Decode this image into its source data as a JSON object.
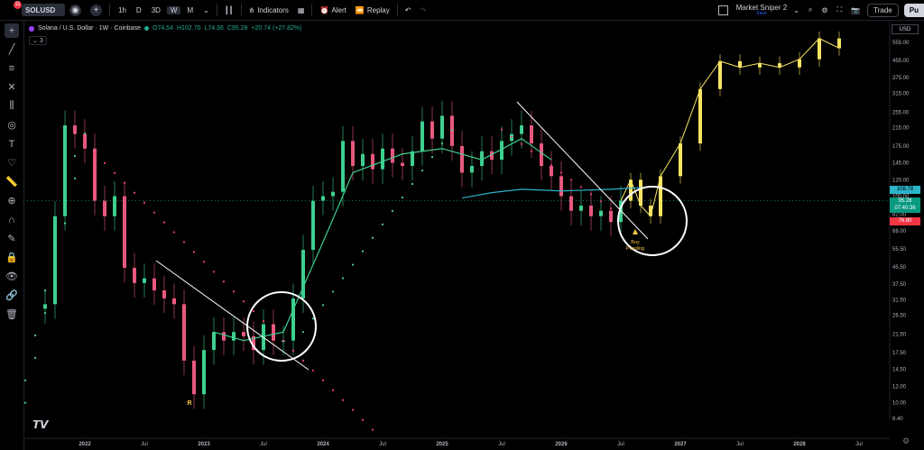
{
  "toolbar": {
    "notification_count": "11",
    "symbol": "SOLUSD",
    "timeframes": [
      "1h",
      "D",
      "3D",
      "W",
      "M"
    ],
    "active_timeframe": "W",
    "indicators_label": "Indicators",
    "alert_label": "Alert",
    "replay_label": "Replay",
    "layout_name": "Market Sniper 2",
    "layout_status": "Save",
    "trade_label": "Trade",
    "publish_label": "Pu"
  },
  "legend": {
    "title": "Solana / U.S. Dollar · 1W · Coinbase",
    "open": "O74.54",
    "high": "H102.70",
    "low": "L74.36",
    "close": "C95.28",
    "change": "+20.74 (+27.82%)",
    "indicator_count": "3"
  },
  "price_axis": {
    "currency": "USD",
    "price_tags": [
      {
        "value": "108.78",
        "color": "#2bb3c8"
      },
      {
        "value": "95.28",
        "color": "#089981"
      },
      {
        "value": "07:40:36",
        "color": "#089981"
      },
      {
        "value": "76.80",
        "color": "#f23645"
      }
    ]
  },
  "annotations": {
    "r_marker": "R",
    "buy_signal_line1": "Buy",
    "buy_signal_line2": "Pending"
  },
  "chart_data": {
    "type": "candlestick",
    "symbol": "SOLUSD",
    "exchange": "Coinbase",
    "interval": "1W",
    "scale": "log",
    "grid": false,
    "y_ticks": [
      555.0,
      455.0,
      375.0,
      315.0,
      255.0,
      215.0,
      175.0,
      145.0,
      120.0,
      100.0,
      82.0,
      68.0,
      55.5,
      45.5,
      37.5,
      31.5,
      26.5,
      21.5,
      17.5,
      14.5,
      12.0,
      10.0,
      8.4
    ],
    "x_ticks": [
      "2022",
      "Jul",
      "2023",
      "Jul",
      "2024",
      "Jul",
      "2025",
      "Jul",
      "2026",
      "Jul",
      "2027",
      "Jul",
      "2028",
      "Jul"
    ],
    "series": [
      {
        "name": "Historical price",
        "x": [
          "2021-09",
          "2021-10",
          "2021-11",
          "2021-12",
          "2022-01",
          "2022-02",
          "2022-03",
          "2022-04",
          "2022-05",
          "2022-06",
          "2022-07",
          "2022-08",
          "2022-09",
          "2022-10",
          "2022-11",
          "2022-12",
          "2023-01",
          "2023-02",
          "2023-03",
          "2023-04",
          "2023-05",
          "2023-06",
          "2023-07",
          "2023-08",
          "2023-09",
          "2023-10",
          "2023-11",
          "2023-12",
          "2024-01",
          "2024-02",
          "2024-03",
          "2024-04",
          "2024-05",
          "2024-06",
          "2024-07",
          "2024-08",
          "2024-09",
          "2024-10",
          "2024-11",
          "2024-12",
          "2025-01",
          "2025-02",
          "2025-03",
          "2025-04",
          "2025-05",
          "2025-06",
          "2025-07",
          "2025-08",
          "2025-09",
          "2025-10",
          "2025-11",
          "2025-12",
          "2026-01",
          "2026-02",
          "2026-03",
          "2026-04",
          "2026-05",
          "2026-06",
          "2026-07"
        ],
        "close": [
          30,
          80,
          220,
          200,
          170,
          95,
          80,
          100,
          45,
          38,
          40,
          35,
          32,
          30,
          16,
          11,
          18,
          22,
          20,
          22,
          21,
          18,
          24,
          20,
          20,
          32,
          55,
          95,
          100,
          105,
          185,
          140,
          160,
          135,
          170,
          145,
          140,
          165,
          230,
          190,
          245,
          175,
          130,
          140,
          165,
          150,
          185,
          200,
          220,
          180,
          140,
          125,
          100,
          85,
          90,
          80,
          85,
          75,
          95
        ]
      },
      {
        "name": "Projected price",
        "x": [
          "2026-08",
          "2026-09",
          "2026-10",
          "2026-11",
          "2027-01",
          "2027-03",
          "2027-05",
          "2027-07",
          "2027-09",
          "2027-11",
          "2028-01",
          "2028-03",
          "2028-05"
        ],
        "close": [
          120,
          90,
          80,
          125,
          180,
          330,
          450,
          420,
          440,
          420,
          460,
          580,
          520
        ]
      }
    ],
    "annotations": [
      "R",
      "Buy Pending"
    ]
  }
}
